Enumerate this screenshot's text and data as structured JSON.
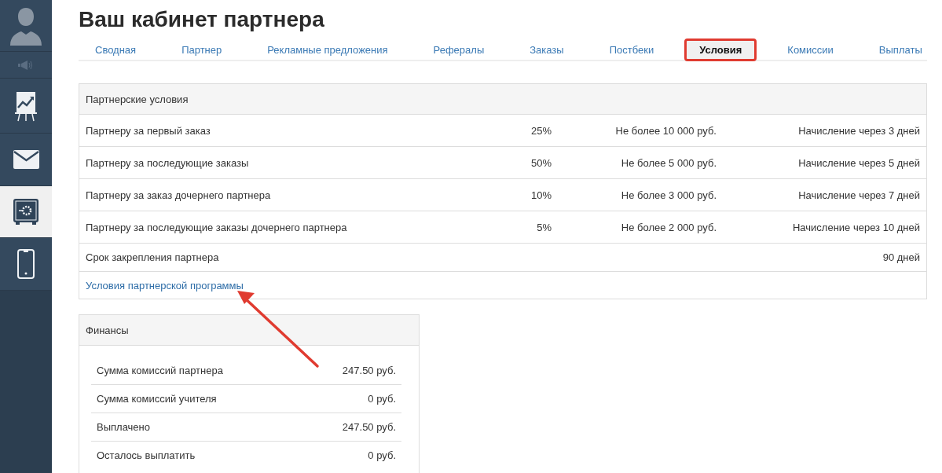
{
  "sidebar": {
    "items": [
      {
        "kind": "avatar",
        "selected": false
      },
      {
        "kind": "speaker",
        "selected": false
      },
      {
        "kind": "chart",
        "selected": false
      },
      {
        "kind": "mail",
        "selected": false
      },
      {
        "kind": "safe",
        "selected": true
      },
      {
        "kind": "phone",
        "selected": false
      }
    ]
  },
  "title": "Ваш кабинет партнера",
  "tabs": [
    {
      "label": "Сводная",
      "selected": false
    },
    {
      "label": "Партнер",
      "selected": false
    },
    {
      "label": "Рекламные предложения",
      "selected": false
    },
    {
      "label": "Рефералы",
      "selected": false
    },
    {
      "label": "Заказы",
      "selected": false
    },
    {
      "label": "Постбеки",
      "selected": false
    },
    {
      "label": "Условия",
      "selected": true
    },
    {
      "label": "Комиссии",
      "selected": false
    },
    {
      "label": "Выплаты",
      "selected": false
    }
  ],
  "conditions": {
    "title": "Партнерские условия",
    "rows": [
      {
        "label": "Партнеру за первый заказ",
        "percent": "25%",
        "limit": "Не более 10 000 руб.",
        "accrual": "Начисление через 3 дней"
      },
      {
        "label": "Партнеру за последующие заказы",
        "percent": "50%",
        "limit": "Не более 5 000 руб.",
        "accrual": "Начисление через 5 дней"
      },
      {
        "label": "Партнеру за заказ дочернего партнера",
        "percent": "10%",
        "limit": "Не более 3 000 руб.",
        "accrual": "Начисление через 7 дней"
      },
      {
        "label": "Партнеру за последующие заказы дочернего партнера",
        "percent": "5%",
        "limit": "Не более 2 000 руб.",
        "accrual": "Начисление через 10 дней"
      }
    ],
    "term": {
      "label": "Срок закрепления партнера",
      "value": "90 дней"
    },
    "link": "Условия партнерской программы"
  },
  "finance": {
    "title": "Финансы",
    "rows": [
      {
        "label": "Сумма комиссий партнера",
        "value": "247.50 руб."
      },
      {
        "label": "Сумма комиссий учителя",
        "value": "0 руб."
      },
      {
        "label": "Выплачено",
        "value": "247.50 руб."
      },
      {
        "label": "Осталось выплатить",
        "value": "0 руб."
      }
    ]
  }
}
